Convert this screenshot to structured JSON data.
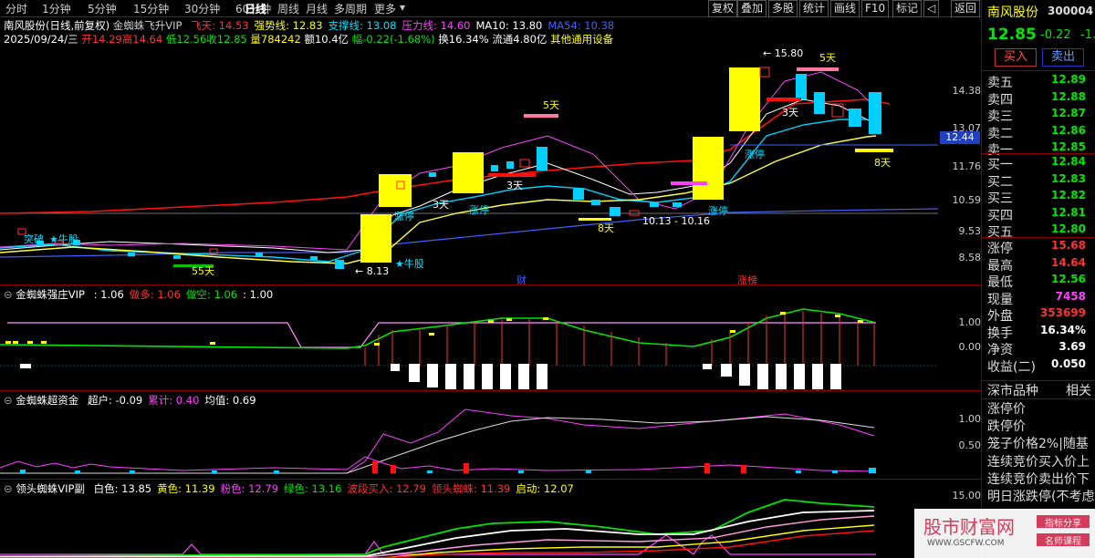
{
  "topbar": {
    "periods": [
      "分时",
      "1分钟",
      "5分钟",
      "15分钟",
      "30分钟",
      "60分钟",
      "日线",
      "周线",
      "月线",
      "多周期",
      "更多"
    ],
    "active_period": "日线",
    "buttons": [
      "复权",
      "叠加",
      "多股",
      "统计",
      "画线",
      "F10",
      "标记",
      "◁",
      "返回"
    ]
  },
  "chart": {
    "title": "南风股份(日线,前复权)",
    "indicator_name": "金蜘蛛飞升VIP",
    "indicator_values": [
      {
        "label": "飞天: 14.53",
        "color": "#ff3232"
      },
      {
        "label": "强势线: 12.83",
        "color": "#ffff00"
      },
      {
        "label": "支撑线: 13.08",
        "color": "#00e0ff"
      },
      {
        "label": "压力线: 14.60",
        "color": "#ff40ff"
      },
      {
        "label": "MA10: 13.80",
        "color": "#ffffff"
      },
      {
        "label": "MA54: 10.38",
        "color": "#4060ff"
      }
    ],
    "ohlc": {
      "date": "2025/09/24/三",
      "open": "开14.29",
      "high": "高14.64",
      "low": "低12.56",
      "close": "收12.85",
      "volume": "量784242",
      "amount": "额10.4亿",
      "change": "幅-0.22(-1.68%)",
      "turnover": "换16.34%",
      "float": "流通4.80亿",
      "sector": "其他通用设备"
    },
    "price_axis": [
      "14.38",
      "13.07",
      "11.76",
      "10.59",
      "9.53",
      "8.58"
    ],
    "current_price_label": "12.44",
    "annotations": [
      {
        "text": "5天",
        "color": "#ffff00"
      },
      {
        "text": "5天",
        "color": "#ffff00"
      },
      {
        "text": "3天",
        "color": "#ffffff"
      },
      {
        "text": "3天",
        "color": "#ffffff"
      },
      {
        "text": "3天",
        "color": "#ffffff"
      },
      {
        "text": "8天",
        "color": "#ffff00"
      },
      {
        "text": "8天",
        "color": "#ffff00"
      },
      {
        "text": "55天",
        "color": "#ffff00"
      },
      {
        "text": "涨停",
        "color": "#00e0ff"
      },
      {
        "text": "涨停",
        "color": "#00e0ff"
      },
      {
        "text": "涨停",
        "color": "#00e0ff"
      },
      {
        "text": "涨停",
        "color": "#00e0ff"
      },
      {
        "text": "10.13 - 10.16",
        "color": "#ffffff"
      },
      {
        "text": "← 15.80",
        "color": "#ffffff"
      },
      {
        "text": "← 8.13",
        "color": "#ffffff"
      },
      {
        "text": "★牛股",
        "color": "#00e0ff"
      },
      {
        "text": "★牛股",
        "color": "#00e0ff"
      },
      {
        "text": "突破",
        "color": "#00e0ff"
      },
      {
        "text": "财",
        "color": "#4060ff"
      },
      {
        "text": "涨榜",
        "color": "#ff3232"
      }
    ]
  },
  "indicator2": {
    "name": "金蜘蛛强庄VIP",
    "values": [
      {
        "label": ": 1.06",
        "color": "#ffffff"
      },
      {
        "label": "做多: 1.06",
        "color": "#ff3232"
      },
      {
        "label": "做空: 1.06",
        "color": "#00e600"
      },
      {
        "label": ": 1.00",
        "color": "#ffffff"
      }
    ],
    "axis": [
      "1.00",
      "0.00"
    ]
  },
  "indicator3": {
    "name": "金蜘蛛超资金",
    "values": [
      {
        "label": "超户: -0.09",
        "color": "#ffffff"
      },
      {
        "label": "累计: 0.40",
        "color": "#ff40ff"
      },
      {
        "label": "均值: 0.69",
        "color": "#ffffff"
      }
    ],
    "axis": [
      "1.00",
      "0.50"
    ]
  },
  "indicator4": {
    "name": "领头蜘蛛VIP副",
    "values": [
      {
        "label": "白色: 13.85",
        "color": "#ffffff"
      },
      {
        "label": "黄色: 11.39",
        "color": "#ffff00"
      },
      {
        "label": "粉色: 12.79",
        "color": "#ff40ff"
      },
      {
        "label": "绿色: 13.16",
        "color": "#00e600"
      },
      {
        "label": "波段买入: 12.79",
        "color": "#ff3232"
      },
      {
        "label": "领头蜘蛛: 11.39",
        "color": "#ff3232"
      },
      {
        "label": "启动: 12.07",
        "color": "#ffff00"
      }
    ],
    "axis": [
      "15.00"
    ]
  },
  "right_panel": {
    "stock_name": "南风股份",
    "stock_code": "300004",
    "price": "12.85",
    "change": "-0.22",
    "change_pct": "-1.6",
    "buy_button": "买入",
    "sell_button": "卖出",
    "asks": [
      {
        "label": "卖五",
        "price": "12.89"
      },
      {
        "label": "卖四",
        "price": "12.88"
      },
      {
        "label": "卖三",
        "price": "12.87"
      },
      {
        "label": "卖二",
        "price": "12.86"
      },
      {
        "label": "卖一",
        "price": "12.85"
      }
    ],
    "bids": [
      {
        "label": "买一",
        "price": "12.84"
      },
      {
        "label": "买二",
        "price": "12.83"
      },
      {
        "label": "买三",
        "price": "12.82"
      },
      {
        "label": "买四",
        "price": "12.81"
      },
      {
        "label": "买五",
        "price": "12.80"
      }
    ],
    "stats": [
      {
        "label": "涨停",
        "value": "15.68",
        "color": "#ff3232"
      },
      {
        "label": "最高",
        "value": "14.64",
        "color": "#ff3232"
      },
      {
        "label": "最低",
        "value": "12.56",
        "color": "#00e600"
      },
      {
        "label": "现量",
        "value": "7458",
        "color": "#ff40ff"
      },
      {
        "label": "外盘",
        "value": "353699",
        "color": "#ff3232"
      },
      {
        "label": "换手",
        "value": "16.34%",
        "color": "#ffffff"
      },
      {
        "label": "净资",
        "value": "3.69",
        "color": "#ffffff"
      },
      {
        "label": "收益(二)",
        "value": "0.050",
        "color": "#ffffff"
      }
    ],
    "section_title": "深市品种",
    "section_right": "相关",
    "rules": [
      "涨停价",
      "跌停价",
      "笼子价格2%|随基",
      "连续竞价买入价上",
      "连续竞价卖出价下",
      "明日涨跌停(不考虑"
    ]
  },
  "watermark": {
    "site": "股市财富网",
    "url": "WWW.GSCFW.COM",
    "tag1": "指标分享",
    "tag2": "名师课程"
  }
}
